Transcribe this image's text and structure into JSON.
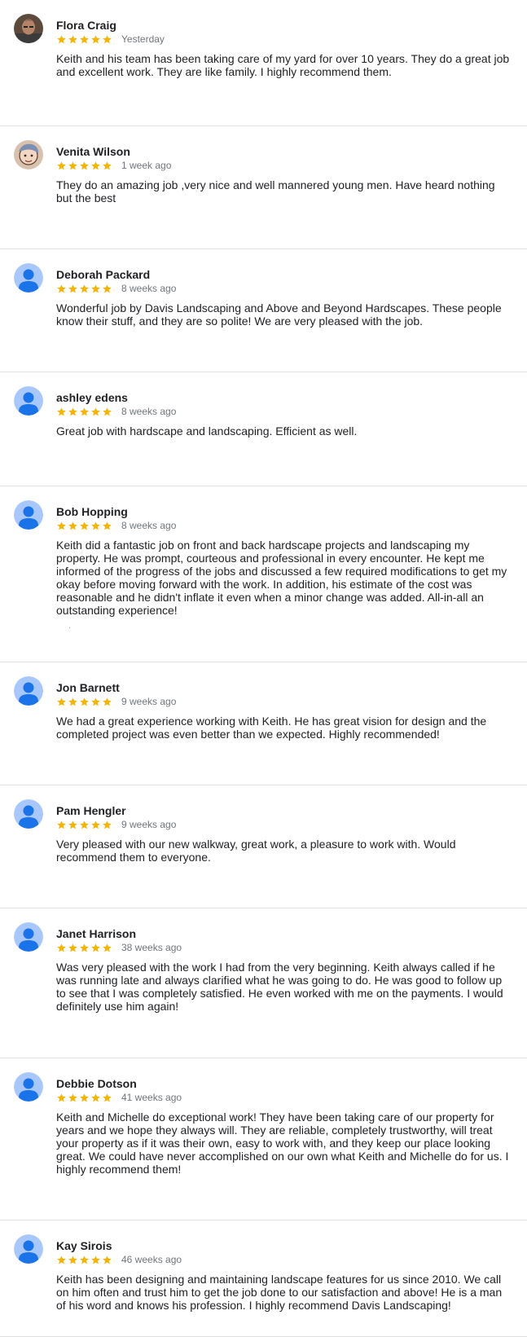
{
  "colors": {
    "star": "#f4b400",
    "avatar_bg": "#a8c7fa",
    "avatar_fg": "#1a73e8",
    "divider": "#e0e0e0"
  },
  "reviews": [
    {
      "name": "Flora Craig",
      "rating": 5,
      "time": "Yesterday",
      "avatar": "photo-avatar",
      "text": "Keith and his team has been taking care of my yard for over 10 years. They do a great job and excellent work. They are like family. I highly recommend them."
    },
    {
      "name": "Venita Wilson",
      "rating": 5,
      "time": "1 week ago",
      "avatar": "illustrated-avatar",
      "text": "They do an amazing job ,very nice and well mannered young men. Have heard nothing but the best"
    },
    {
      "name": "Deborah Packard",
      "rating": 5,
      "time": "8 weeks ago",
      "avatar": "default-person-avatar",
      "text": "Wonderful job by Davis Landscaping and Above and Beyond Hardscapes. These people know their stuff, and they are so polite! We are very pleased with the job."
    },
    {
      "name": "ashley edens",
      "rating": 5,
      "time": "8 weeks ago",
      "avatar": "default-person-avatar",
      "text": "Great job with hardscape and landscaping. Efficient as well."
    },
    {
      "name": "Bob Hopping",
      "rating": 5,
      "time": "8 weeks ago",
      "avatar": "default-person-avatar",
      "text": "Keith did a fantastic job on front and back hardscape projects and landscaping my property. He was prompt, courteous and professional in every encounter. He kept me informed of the progress of the jobs and discussed a few required modifications to get my okay before moving forward with the work. In addition, his estimate of the cost was reasonable and he didn't inflate it even when a minor change was added. All-in-all an outstanding experience!"
    },
    {
      "name": "Jon Barnett",
      "rating": 5,
      "time": "9 weeks ago",
      "avatar": "default-person-avatar",
      "text": "We had a great experience working with Keith. He has great vision for design and the completed project was even better than we expected. Highly recommended!"
    },
    {
      "name": "Pam Hengler",
      "rating": 5,
      "time": "9 weeks ago",
      "avatar": "default-person-avatar",
      "text": "Very pleased with our new walkway, great work, a pleasure to work with. Would recommend them to everyone."
    },
    {
      "name": "Janet Harrison",
      "rating": 5,
      "time": "38 weeks ago",
      "avatar": "default-person-avatar",
      "text": "Was very pleased with the work I had from the very beginning. Keith always called if he was running late and always clarified what he was going to do. He was good to follow up to see that I was completely satisfied. He even worked with me on the payments. I would definitely use him again!"
    },
    {
      "name": "Debbie Dotson",
      "rating": 5,
      "time": "41 weeks ago",
      "avatar": "default-person-avatar",
      "text": "Keith and Michelle do exceptional work! They have been taking care of our property for years and we hope they always will. They are reliable, completely trustworthy, will treat your property as if it was their own, easy to work with, and they keep our place looking great. We could have never accomplished on our own what Keith and Michelle do for us. I highly recommend them!"
    },
    {
      "name": "Kay Sirois",
      "rating": 5,
      "time": "46 weeks ago",
      "avatar": "default-person-avatar",
      "text": "Keith has been designing and maintaining landscape features for us since 2010. We call on him often and trust him to get the job done to our satisfaction and above! He is a man of his word and knows his profession. I highly recommend Davis Landscaping!"
    }
  ]
}
